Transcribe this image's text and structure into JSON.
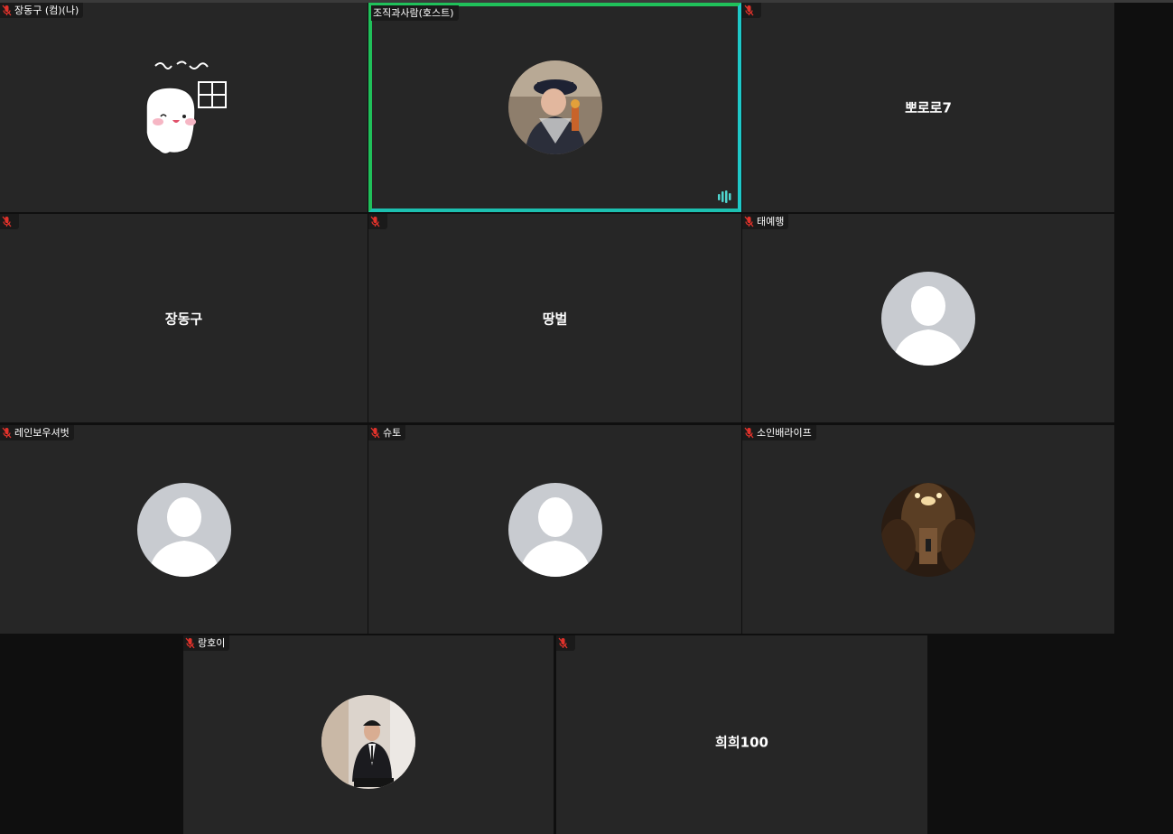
{
  "tiles": [
    {
      "label": "장동구 (컴)(나)",
      "center": ""
    },
    {
      "label": "조직과사람(호스트)",
      "center": ""
    },
    {
      "label": "",
      "center": "뽀로로7"
    },
    {
      "label": "",
      "center": "장동구"
    },
    {
      "label": "",
      "center": "땅벌"
    },
    {
      "label": "태예행",
      "center": ""
    },
    {
      "label": "레인보우셔벗",
      "center": ""
    },
    {
      "label": "슈토",
      "center": ""
    },
    {
      "label": "소인배라이프",
      "center": ""
    },
    {
      "label": "랑호이",
      "center": ""
    },
    {
      "label": "",
      "center": "희희100"
    }
  ],
  "colors": {
    "tile_bg": "#262626",
    "page_bg": "#0f0f0f",
    "active_border_start": "#20c05a",
    "active_border_end": "#1ec8c8",
    "muted_mic": "#e0322b",
    "speaking_bars": "#4fd6d0"
  },
  "icons": {
    "muted": "mic-muted-icon",
    "speaking": "audio-bars-icon",
    "placeholder": "person-silhouette-icon"
  }
}
